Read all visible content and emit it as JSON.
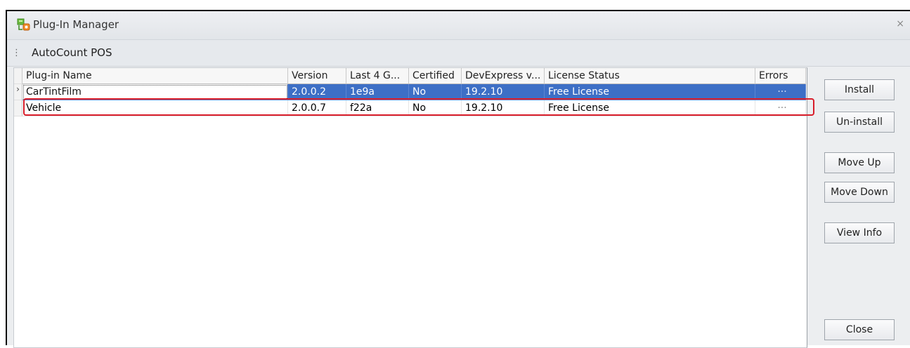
{
  "window": {
    "title": "Plug-In Manager",
    "close_glyph": "×",
    "icon": "plugin-manager-icon"
  },
  "toolbar": {
    "grip_glyph": "⋮",
    "app_name": "AutoCount POS"
  },
  "grid": {
    "columns": [
      "Plug-in Name",
      "Version",
      "Last 4 G...",
      "Certified",
      "DevExpress v...",
      "License Status",
      "Errors"
    ],
    "current_row_glyph": "›",
    "rows": [
      {
        "name": "CarTintFilm",
        "version": "2.0.0.2",
        "last4": "1e9a",
        "certified": "No",
        "devexpress": "19.2.10",
        "license": "Free License",
        "errors": "···",
        "selected": true
      },
      {
        "name": "Vehicle",
        "version": "2.0.0.7",
        "last4": "f22a",
        "certified": "No",
        "devexpress": "19.2.10",
        "license": "Free License",
        "errors": "···",
        "selected": false
      }
    ]
  },
  "buttons": {
    "install": "Install",
    "uninstall": "Un-install",
    "move_up": "Move Up",
    "move_down": "Move Down",
    "view_info": "View Info",
    "close": "Close"
  },
  "colors": {
    "selection": "#3d6fc6",
    "highlight_border": "#d81d2a"
  }
}
